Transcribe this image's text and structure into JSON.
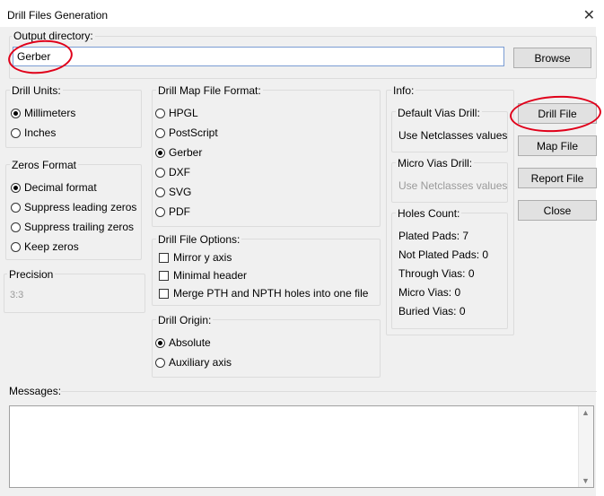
{
  "window": {
    "title": "Drill Files Generation",
    "close_glyph": "✕"
  },
  "output": {
    "label": "Output directory:",
    "value": "Gerber",
    "browse_label": "Browse"
  },
  "drill_units": {
    "label": "Drill Units:",
    "options": [
      "Millimeters",
      "Inches"
    ],
    "selected": "Millimeters"
  },
  "zeros_format": {
    "label": "Zeros Format",
    "options": [
      "Decimal format",
      "Suppress leading zeros",
      "Suppress trailing zeros",
      "Keep zeros"
    ],
    "selected": "Decimal format"
  },
  "precision": {
    "label": "Precision",
    "value": "3:3"
  },
  "map_format": {
    "label": "Drill Map File Format:",
    "options": [
      "HPGL",
      "PostScript",
      "Gerber",
      "DXF",
      "SVG",
      "PDF"
    ],
    "selected": "Gerber"
  },
  "file_options": {
    "label": "Drill File Options:",
    "items": [
      "Mirror y axis",
      "Minimal header",
      "Merge PTH and NPTH holes into one file"
    ]
  },
  "origin": {
    "label": "Drill Origin:",
    "options": [
      "Absolute",
      "Auxiliary axis"
    ],
    "selected": "Absolute"
  },
  "info": {
    "label": "Info:",
    "default_vias": {
      "label": "Default Vias Drill:",
      "value": "Use Netclasses values"
    },
    "micro_vias": {
      "label": "Micro Vias Drill:",
      "value": "Use Netclasses values"
    },
    "holes": {
      "label": "Holes Count:",
      "plated_pads": "Plated Pads: 7",
      "not_plated_pads": "Not Plated Pads: 0",
      "through_vias": "Through Vias: 0",
      "micro_vias": "Micro Vias: 0",
      "buried_vias": "Buried Vias: 0"
    }
  },
  "buttons": {
    "drill_file": "Drill File",
    "map_file": "Map File",
    "report_file": "Report File",
    "close": "Close"
  },
  "messages": {
    "label": "Messages:"
  },
  "colors": {
    "annotation": "#e0001a",
    "accent_border": "#7a9cd3"
  }
}
